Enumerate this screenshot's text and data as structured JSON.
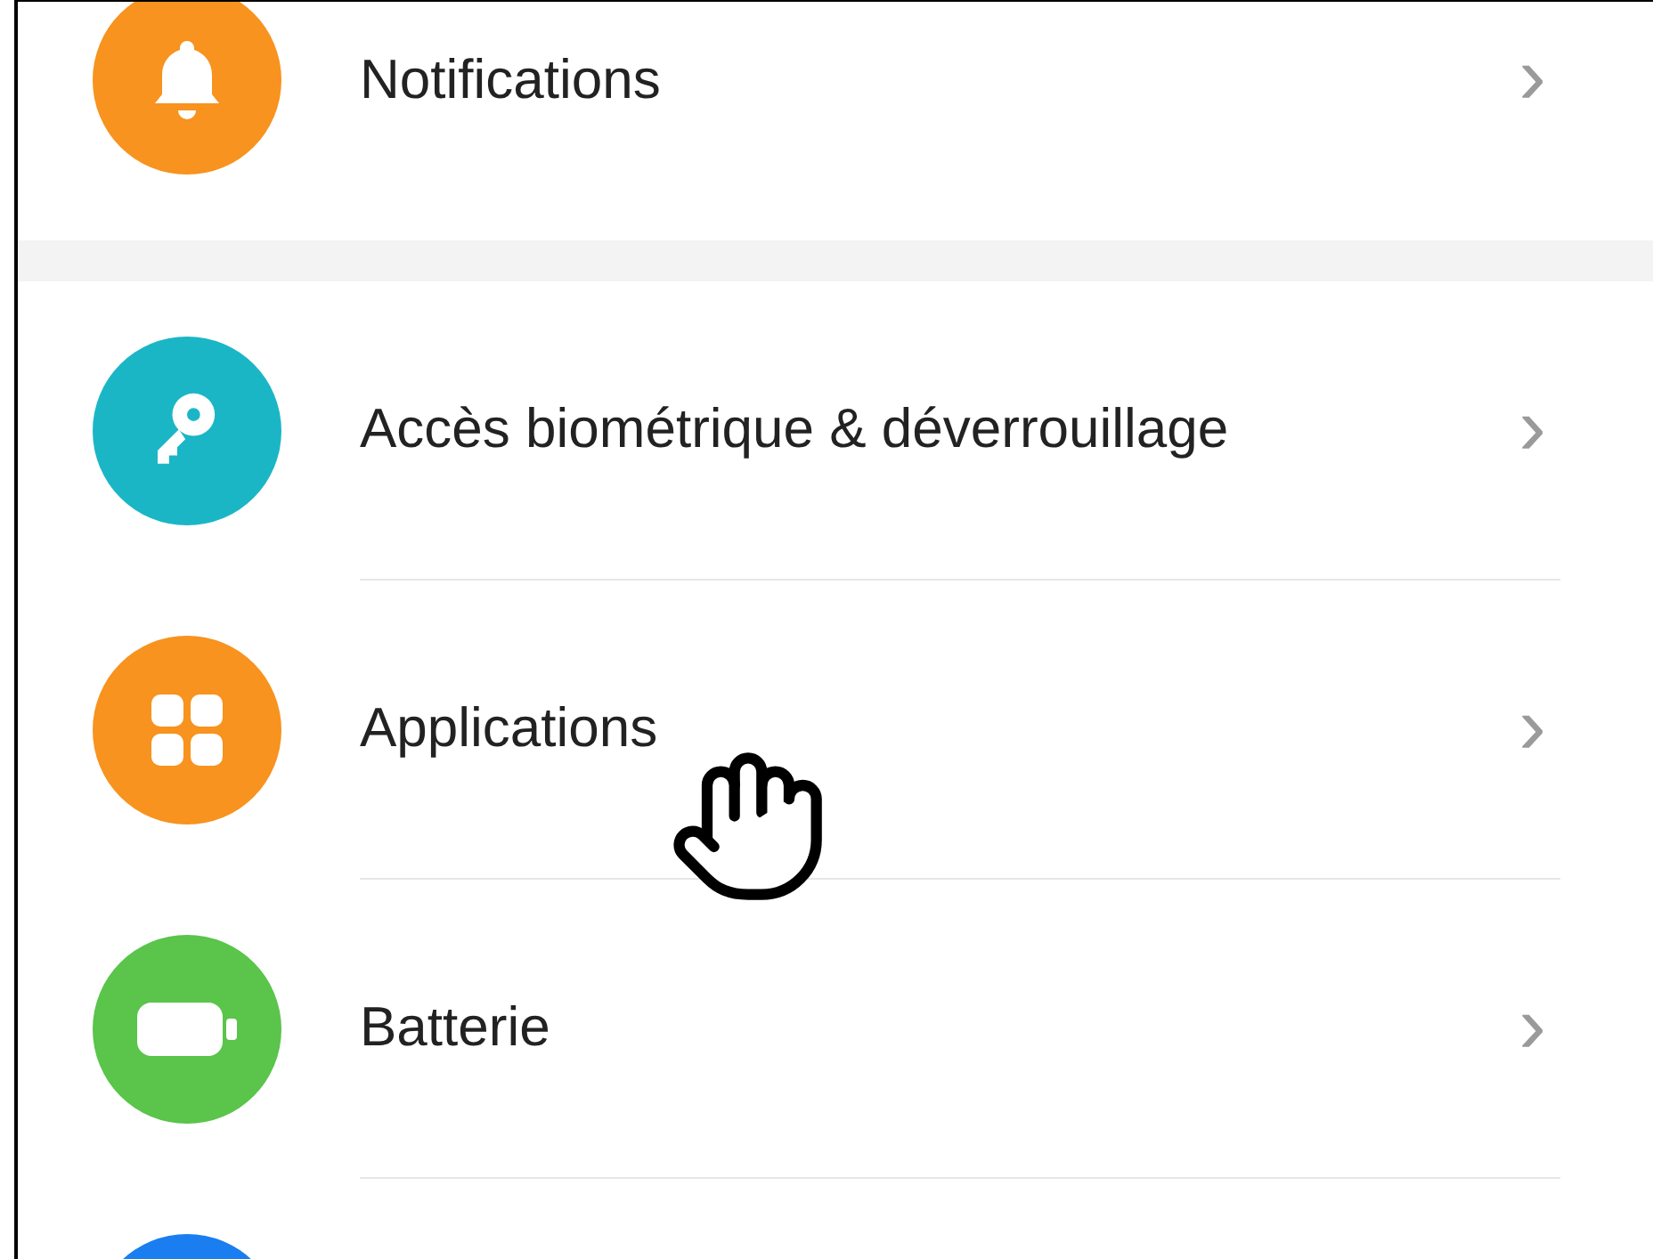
{
  "groups": [
    {
      "items": [
        {
          "kind": "bell",
          "label": "Notifications",
          "color": "#f7931e",
          "chevron": "›"
        }
      ]
    },
    {
      "items": [
        {
          "kind": "key",
          "label": "Accès biométrique & déverrouillage",
          "color": "#1bb6c6",
          "chevron": "›"
        },
        {
          "kind": "grid",
          "label": "Applications",
          "color": "#f7931e",
          "chevron": "›"
        },
        {
          "kind": "battery",
          "label": "Batterie",
          "color": "#5ac44b",
          "chevron": "›"
        },
        {
          "kind": "partial",
          "color": "#1a7ef0"
        }
      ]
    }
  ]
}
